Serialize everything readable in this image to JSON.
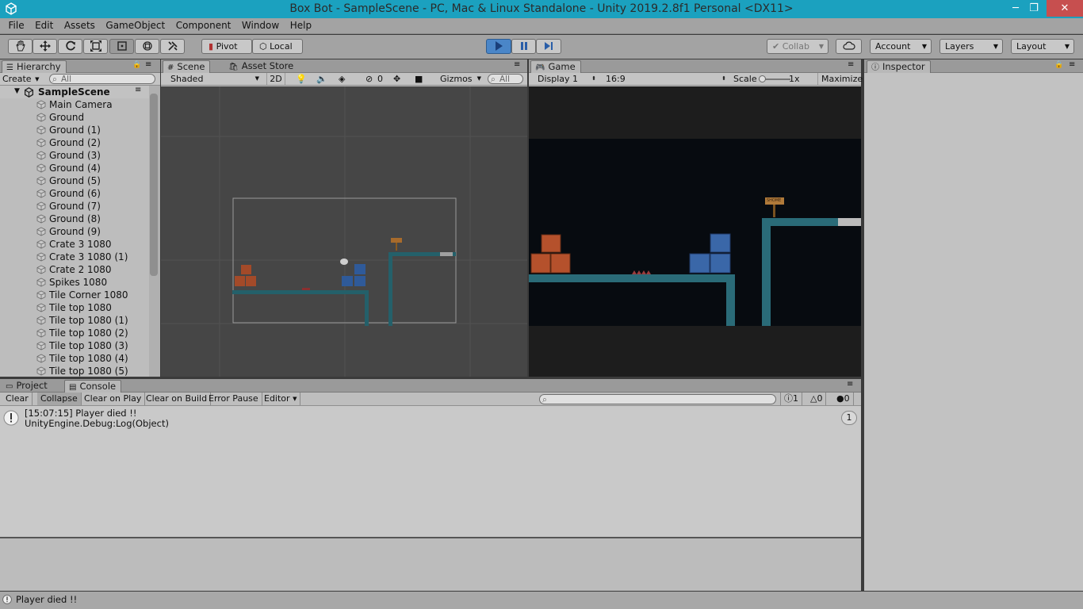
{
  "window": {
    "title": "Box Bot - SampleScene - PC, Mac & Linux Standalone - Unity 2019.2.8f1 Personal <DX11>",
    "minimize": "─",
    "maximize": "❐",
    "close": "✕"
  },
  "menu": [
    "File",
    "Edit",
    "Assets",
    "GameObject",
    "Component",
    "Window",
    "Help"
  ],
  "toolbar": {
    "pivot": "Pivot",
    "local": "Local",
    "collab": "Collab",
    "account": "Account",
    "layers": "Layers",
    "layout": "Layout"
  },
  "hierarchy": {
    "tab": "Hierarchy",
    "create": "Create",
    "search_placeholder": "All",
    "scene": "SampleScene",
    "items": [
      "Main Camera",
      "Ground",
      "Ground (1)",
      "Ground (2)",
      "Ground (3)",
      "Ground (4)",
      "Ground (5)",
      "Ground (6)",
      "Ground (7)",
      "Ground (8)",
      "Ground (9)",
      "Crate 3 1080",
      "Crate 3 1080 (1)",
      "Crate 2 1080",
      "Spikes 1080",
      "Tile Corner 1080",
      "Tile top 1080",
      "Tile top 1080 (1)",
      "Tile top 1080 (2)",
      "Tile top 1080 (3)",
      "Tile top 1080 (4)",
      "Tile top 1080 (5)"
    ]
  },
  "scene": {
    "tab": "Scene",
    "tab2": "Asset Store",
    "shading": "Shaded",
    "mode2d": "2D",
    "layer_count": "0",
    "gizmos": "Gizmos",
    "search_placeholder": "All"
  },
  "game": {
    "tab": "Game",
    "display": "Display 1",
    "aspect": "16:9",
    "scale_label": "Scale",
    "scale_value": "1x",
    "maximize": "Maximize O",
    "sign_text": "SHOME"
  },
  "inspector": {
    "tab": "Inspector"
  },
  "console": {
    "tab_project": "Project",
    "tab_console": "Console",
    "buttons": [
      "Clear",
      "Collapse",
      "Clear on Play",
      "Clear on Build",
      "Error Pause",
      "Editor"
    ],
    "info_count": "1",
    "warn_count": "0",
    "error_count": "0",
    "entry_line1": "[15:07:15] Player died !!",
    "entry_line2": "UnityEngine.Debug:Log(Object)",
    "entry_count": "1"
  },
  "status": {
    "message": "Player died !!"
  },
  "colors": {
    "title_bar": "#1ba1bf",
    "play_active": "#4a86c8",
    "crate_orange": "#b5512c",
    "crate_blue": "#3a67a8",
    "tile_teal": "#2a6b78"
  }
}
